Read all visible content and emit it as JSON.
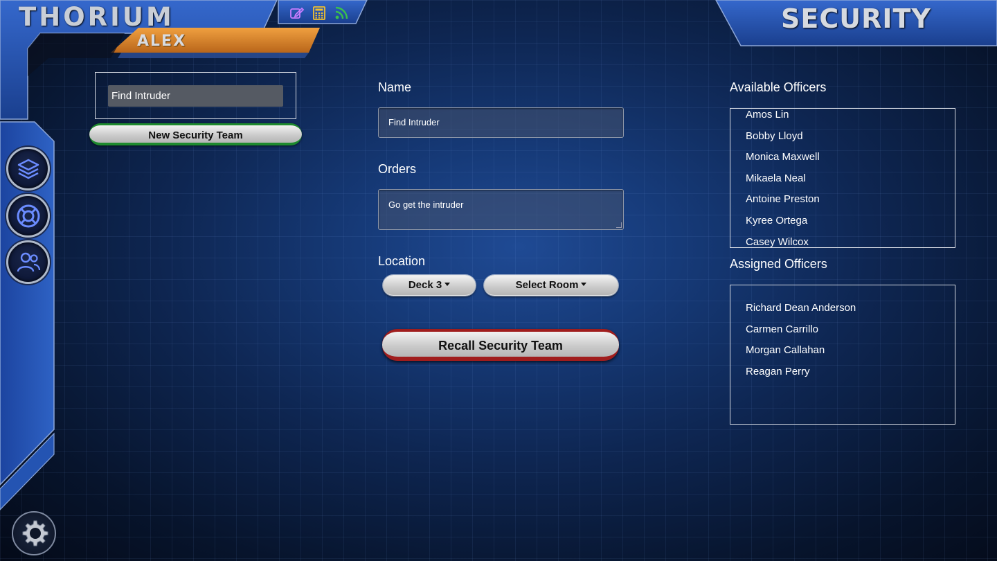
{
  "app": {
    "brand": "THORIUM",
    "user": "ALEX",
    "station": "SECURITY",
    "top_icons": [
      "edit-icon",
      "calculator-icon",
      "rss-feed-icon"
    ],
    "side_nav": [
      "layers-icon",
      "lifebuoy-icon",
      "crew-users-icon"
    ],
    "settings_icon": "gear-icon"
  },
  "teams": {
    "items": [
      "Find Intruder"
    ],
    "new_button": "New Security Team"
  },
  "form": {
    "name_label": "Name",
    "name_value": "Find Intruder",
    "orders_label": "Orders",
    "orders_value": "Go get the intruder",
    "location_label": "Location",
    "deck_select": "Deck 3",
    "room_select": "Select Room",
    "recall_button": "Recall Security Team"
  },
  "available": {
    "title": "Available Officers",
    "officers": [
      "Amos Lin",
      "Bobby Lloyd",
      "Monica Maxwell",
      "Mikaela Neal",
      "Antoine Preston",
      "Kyree Ortega",
      "Casey Wilcox"
    ]
  },
  "assigned": {
    "title": "Assigned Officers",
    "officers": [
      "Richard Dean Anderson",
      "Carmen Carrillo",
      "Morgan Callahan",
      "Reagan Perry"
    ]
  },
  "colors": {
    "frame_blue": "#2552b0",
    "accent_orange": "#e08a24",
    "new_team_green": "#1e8a2e",
    "recall_red": "#a01d1d"
  }
}
